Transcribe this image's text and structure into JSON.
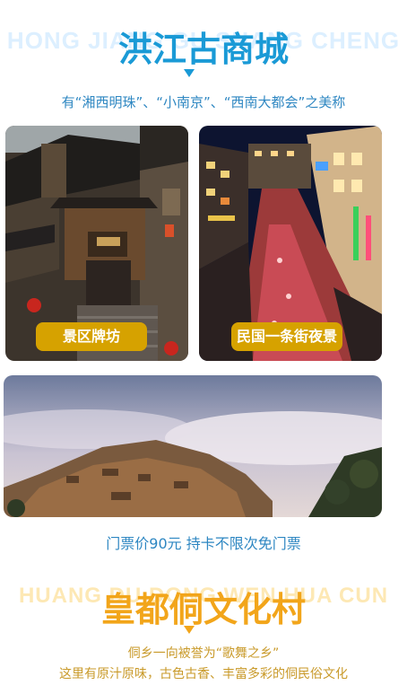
{
  "section1": {
    "bg_word": "HONG JIANG GU SHANG CHENG",
    "title": "洪江古商城",
    "subtitle": "有“湘西明珠”、“小南京”、“西南大都会”之美称",
    "photos": [
      {
        "label": "景区牌坊"
      },
      {
        "label": "民国一条街夜景"
      }
    ],
    "ticket_text": "门票价90元 持卡不限次免门票"
  },
  "section2": {
    "bg_word": "HUANG DU DONG WEN HUA CUN",
    "title": "皇都侗文化村",
    "desc_line1": "侗乡一向被誉为“歌舞之乡”",
    "desc_line2": "这里有原汁原味，古色古香、丰富多彩的侗民俗文化"
  },
  "colors": {
    "blue": "#1a9ad6",
    "gold": "#f2a51a",
    "pill": "#d6a200",
    "bg_word_blue": "#dcefff",
    "bg_word_gold": "#fde8b4",
    "text_blue": "#2e87c2",
    "text_gold": "#c99a2a"
  }
}
